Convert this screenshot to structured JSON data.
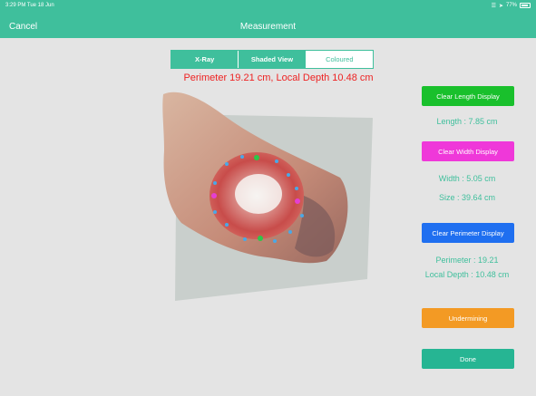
{
  "status_bar": {
    "time_date": "3:29 PM  Tue 18 Jun",
    "battery": "77%"
  },
  "nav": {
    "cancel": "Cancel",
    "title": "Measurement"
  },
  "view_modes": {
    "selected": "Coloured",
    "items": [
      {
        "label": "X-Ray"
      },
      {
        "label": "Shaded View"
      },
      {
        "label": "Coloured"
      }
    ]
  },
  "banner": {
    "text": "Perimeter 19.21 cm, Local Depth 10.48 cm"
  },
  "panel": {
    "clear_length": "Clear Length Display",
    "length": "Length : 7.85 cm",
    "clear_width": "Clear Width Display",
    "width": "Width : 5.05 cm",
    "size": "Size : 39.64 cm",
    "clear_perimeter": "Clear Perimeter Display",
    "perimeter": "Perimeter : 19.21",
    "local_depth": "Local Depth : 10.48 cm",
    "undermining": "Undermining",
    "done": "Done"
  },
  "colors": {
    "accent": "#3fbf9c",
    "banner_text": "#ee2222",
    "length_button": "#19c02c",
    "width_button": "#ef38d9",
    "perimeter_button": "#1f6ff0",
    "undermining_button": "#f39a24",
    "done_button": "#26b593"
  }
}
